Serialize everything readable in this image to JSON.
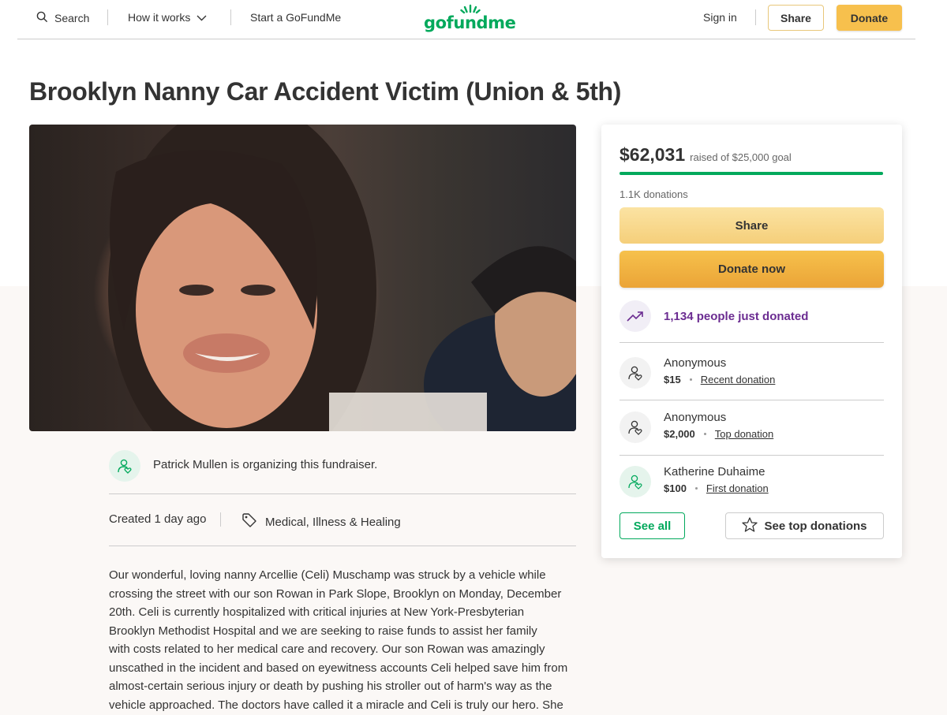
{
  "header": {
    "search_label": "Search",
    "how_it_works_label": "How it works",
    "start_label": "Start a GoFundMe",
    "logo_text": "gofundme",
    "sign_in_label": "Sign in",
    "share_label": "Share",
    "donate_label": "Donate"
  },
  "campaign": {
    "title": "Brooklyn Nanny Car Accident Victim (Union & 5th)",
    "organizer_text": "Patrick Mullen is organizing this fundraiser.",
    "created": "Created 1 day ago",
    "category": "Medical, Illness & Healing",
    "story_lines": [
      "Our wonderful, loving nanny Arcellie (Celi) Muschamp was struck by a vehicle while",
      "crossing the street with our son Rowan in Park Slope, Brooklyn on Monday, December",
      "20th. Celi is currently hospitalized with critical injuries at New York-Presbyterian",
      "Brooklyn Methodist Hospital and we are seeking to raise funds to assist her family",
      "with costs related to her medical care and recovery. Our son Rowan was amazingly",
      "unscathed in the incident and based on eyewitness accounts Celi helped save him from",
      "almost-certain serious injury or death by pushing his stroller out of harm's way as the",
      "vehicle approached. The doctors have called it a miracle and Celi is truly our hero. She"
    ]
  },
  "donation_card": {
    "raised_amount": "$62,031",
    "raised_goal_text": "raised of $25,000 goal",
    "progress_fraction": 1.0,
    "donation_count": "1.1K donations",
    "share_label": "Share",
    "donate_label": "Donate now",
    "trend_text": "1,134 people just donated",
    "donors": [
      {
        "name": "Anonymous",
        "amount": "$15",
        "tag": "Recent donation"
      },
      {
        "name": "Anonymous",
        "amount": "$2,000",
        "tag": "Top donation"
      },
      {
        "name": "Katherine Duhaime",
        "amount": "$100",
        "tag": "First donation"
      }
    ],
    "see_all_label": "See all",
    "see_top_label": "See top donations"
  },
  "colors": {
    "brand_green": "#02a95c",
    "donate_yellow": "#f7c04d",
    "trend_purple": "#6b2c91"
  }
}
